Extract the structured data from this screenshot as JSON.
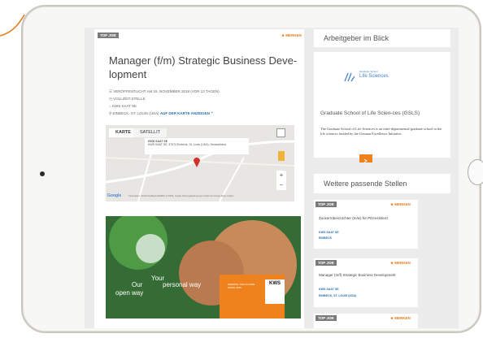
{
  "main": {
    "tag": "TOP JOB",
    "merken": "★ MERKEN",
    "title": "Manager (f/m) Strategic Business Deve-lopment",
    "meta_published": "☰ VERÖFFENTLICHT AM 15. NOVEMBER 2018 (VOR 13 TAGEN)",
    "meta_type": "◷ VOLLZEIT-STELLE",
    "meta_company": "⌂ KWS SAAT SE",
    "meta_location_prefix": "⚲ EINBECK, ST. LOUIS (USA)",
    "meta_location_link": "AUF DER KARTE ANZEIGEN ⌃",
    "map": {
      "tab_map": "KARTE",
      "tab_satellite": "SATELLIT",
      "info_name": "KWS SAAT SE",
      "info_address": "KWS SAAT SE, 37574 Einbeck, St. Louis (USA), Deutschland",
      "google": "Google",
      "footer": "Kartendaten ©2018 GeoBasis-DE/BKG (©2009), Google   Nutzungsbedingungen   Fehler bei Google Maps melden"
    },
    "photo": {
      "text_your": "Your",
      "text_personal": "personal way",
      "text_our": "Our",
      "text_open": "open way",
      "kws_logo": "KWS",
      "kws_tag": "SEEDING THE FUTURE SINCE 1856"
    }
  },
  "sidebar": {
    "heading_employer": "Arbeitgeber im Blick",
    "logo_text": "Life Sciences",
    "logo_small": "Graduate School",
    "employer_name": "Graduate School of Life Scien-ces (GSLS)",
    "employer_desc": "The Graduate School of Life Sciences is an inter-departmental graduate school to the life sciences funded by the German Excellence Initiative.",
    "heading_jobs": "Weitere passende Stellen",
    "jobs": [
      {
        "tag": "TOP JOB",
        "merken": "★ MERKEN",
        "title": "Zuckerrübenzüchter (m/w) für Pilzresistenz",
        "company": "KWS SAAT SE",
        "location": "EINBECK"
      },
      {
        "tag": "TOP JOB",
        "merken": "★ MERKEN",
        "title": "Manager (m/f) Strategic Business Development",
        "company": "KWS SAAT SE",
        "location": "EINBECK, ST. LOUIS (USA)"
      },
      {
        "tag": "TOP JOB",
        "merken": "★ MERKEN",
        "title": "",
        "company": "",
        "location": ""
      }
    ]
  },
  "colors": {
    "accent": "#e07b1a",
    "link": "#2a6fb0",
    "brand_orange": "#f0821e"
  }
}
